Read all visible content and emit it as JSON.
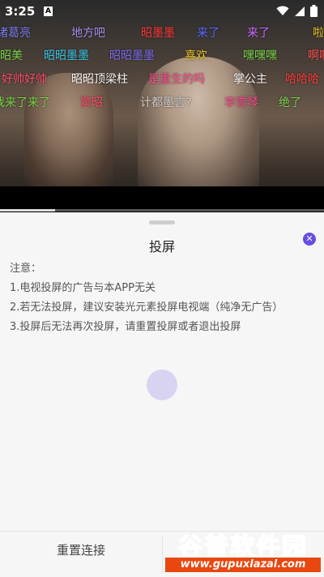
{
  "status_bar": {
    "time": "3:25",
    "notification_icon": "A"
  },
  "video": {
    "progress_fraction": 0.17,
    "danmaku": [
      {
        "text": "诸葛亮",
        "color": "#7a7ef0"
      },
      {
        "text": "地方吧",
        "color": "#a88ff2"
      },
      {
        "text": "昭墨墨",
        "color": "#ff3b3b"
      },
      {
        "text": "来了",
        "color": "#5a6cff"
      },
      {
        "text": "来了",
        "color": "#c86bff"
      },
      {
        "text": "啦",
        "color": "#e6c229"
      },
      {
        "text": "昭美",
        "color": "#7ad44a"
      },
      {
        "text": "昭昭墨墨",
        "color": "#39c7e6"
      },
      {
        "text": "昭昭墨墨",
        "color": "#7a6cf0"
      },
      {
        "text": "喜欢",
        "color": "#e6c229"
      },
      {
        "text": "嘿嘿嘿",
        "color": "#7ad44a"
      },
      {
        "text": "啊啊",
        "color": "#ff5252"
      },
      {
        "text": "好帅好帅",
        "color": "#ff4d6d"
      },
      {
        "text": "昭昭顶梁柱",
        "color": "#f5f5f5"
      },
      {
        "text": "是重生的吗",
        "color": "#ff4d8d"
      },
      {
        "text": "掌公主",
        "color": "#f5f5f5"
      },
      {
        "text": "哈哈哈",
        "color": "#ff3b3b"
      },
      {
        "text": "我来了来了",
        "color": "#7ad44a"
      },
      {
        "text": "窦昭",
        "color": "#ff4d6d"
      },
      {
        "text": "计都墨言?",
        "color": "#d0d0d0"
      },
      {
        "text": "李雪琴",
        "color": "#ff4d8d"
      },
      {
        "text": "绝了",
        "color": "#7ad44a"
      }
    ]
  },
  "sheet": {
    "title": "投屏",
    "notes": [
      "注意：",
      "1.电视投屏的广告与本APP无关",
      "2.若无法投屏，建议安装光元素投屏电视端（纯净无广告）",
      "3.投屏后无法再次投屏，请重置投屏或者退出投屏"
    ],
    "reset_button": "重置连接",
    "accent_color": "#6a4de0"
  },
  "watermark": {
    "title": "谷普软件园",
    "url": "www.gupuxlazal.com"
  }
}
